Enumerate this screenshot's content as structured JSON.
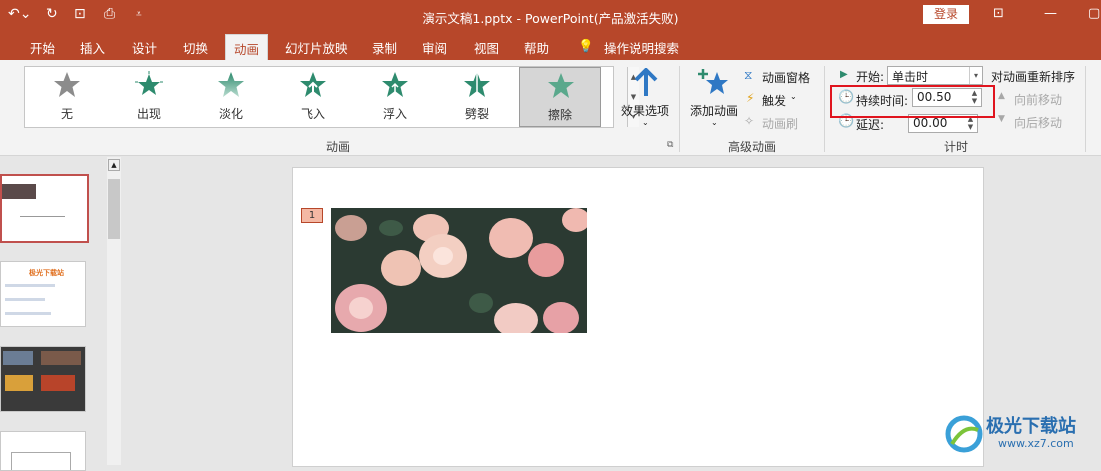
{
  "titlebar": {
    "title": "演示文稿1.pptx  -  PowerPoint(产品激活失败)",
    "login": "登录",
    "quick_access": [
      "undo-icon",
      "redo-icon",
      "start-slideshow-icon",
      "print-preview-icon",
      "customize-icon"
    ]
  },
  "tabs": [
    "开始",
    "插入",
    "设计",
    "切换",
    "动画",
    "幻灯片放映",
    "录制",
    "审阅",
    "视图",
    "帮助",
    "操作说明搜索"
  ],
  "active_tab": "动画",
  "animations": [
    {
      "label": "无",
      "color": "#8c8c8c"
    },
    {
      "label": "出现",
      "color": "#2e8b6e"
    },
    {
      "label": "淡化",
      "color": "#2e8b6e"
    },
    {
      "label": "飞入",
      "color": "#2e8b6e"
    },
    {
      "label": "浮入",
      "color": "#2e8b6e"
    },
    {
      "label": "劈裂",
      "color": "#2e8b6e"
    },
    {
      "label": "擦除",
      "color": "#2e8b6e"
    }
  ],
  "ribbon": {
    "effect_options": "效果选项",
    "group_animation": "动画",
    "add_animation": "添加动画",
    "animation_pane": "动画窗格",
    "trigger": "触发",
    "animation_painter": "动画刷",
    "group_advanced": "高级动画",
    "start_label": "开始:",
    "start_value": "单击时",
    "duration_label": "持续时间:",
    "duration_value": "00.50",
    "delay_label": "延迟:",
    "delay_value": "00.00",
    "reorder_title": "对动画重新排序",
    "move_earlier": "向前移动",
    "move_later": "向后移动",
    "group_timing": "计时"
  },
  "slide": {
    "animation_badge": "1"
  },
  "thumb2_title": "极光下载站",
  "watermark": "极光下载站",
  "watermark_url": "www.xz7.com",
  "colors": {
    "accent": "#b7472a",
    "highlight": "#e0141e"
  }
}
